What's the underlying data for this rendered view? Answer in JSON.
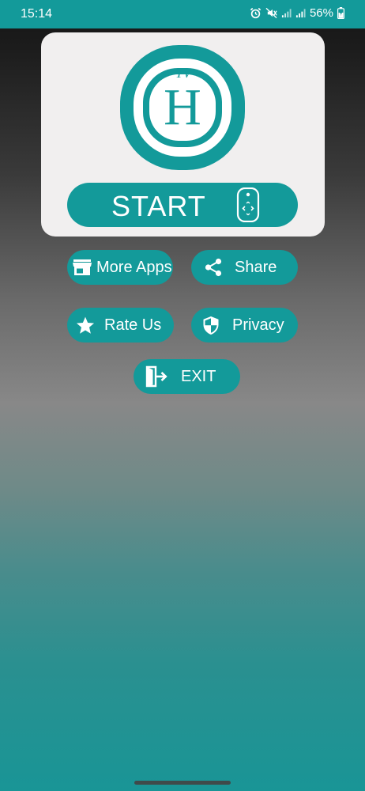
{
  "status_bar": {
    "time": "15:14",
    "battery": "56%",
    "icons": [
      "alarm-icon",
      "mute-vibrate-icon",
      "signal-icon",
      "signal-icon",
      "battery-charging-icon"
    ]
  },
  "logo": {
    "letter": "H",
    "badge": "TV"
  },
  "start_button": {
    "label": "START",
    "icon": "remote-control-icon"
  },
  "menu": {
    "more_apps": {
      "label": "More Apps",
      "icon": "store-icon"
    },
    "share": {
      "label": "Share",
      "icon": "share-icon"
    },
    "rate_us": {
      "label": "Rate Us",
      "icon": "star-icon"
    },
    "privacy": {
      "label": "Privacy",
      "icon": "shield-icon"
    },
    "exit": {
      "label": "EXIT",
      "icon": "exit-door-icon"
    }
  },
  "colors": {
    "accent": "#139a9a",
    "card": "#f1efef",
    "text_on_accent": "#ffffff"
  }
}
